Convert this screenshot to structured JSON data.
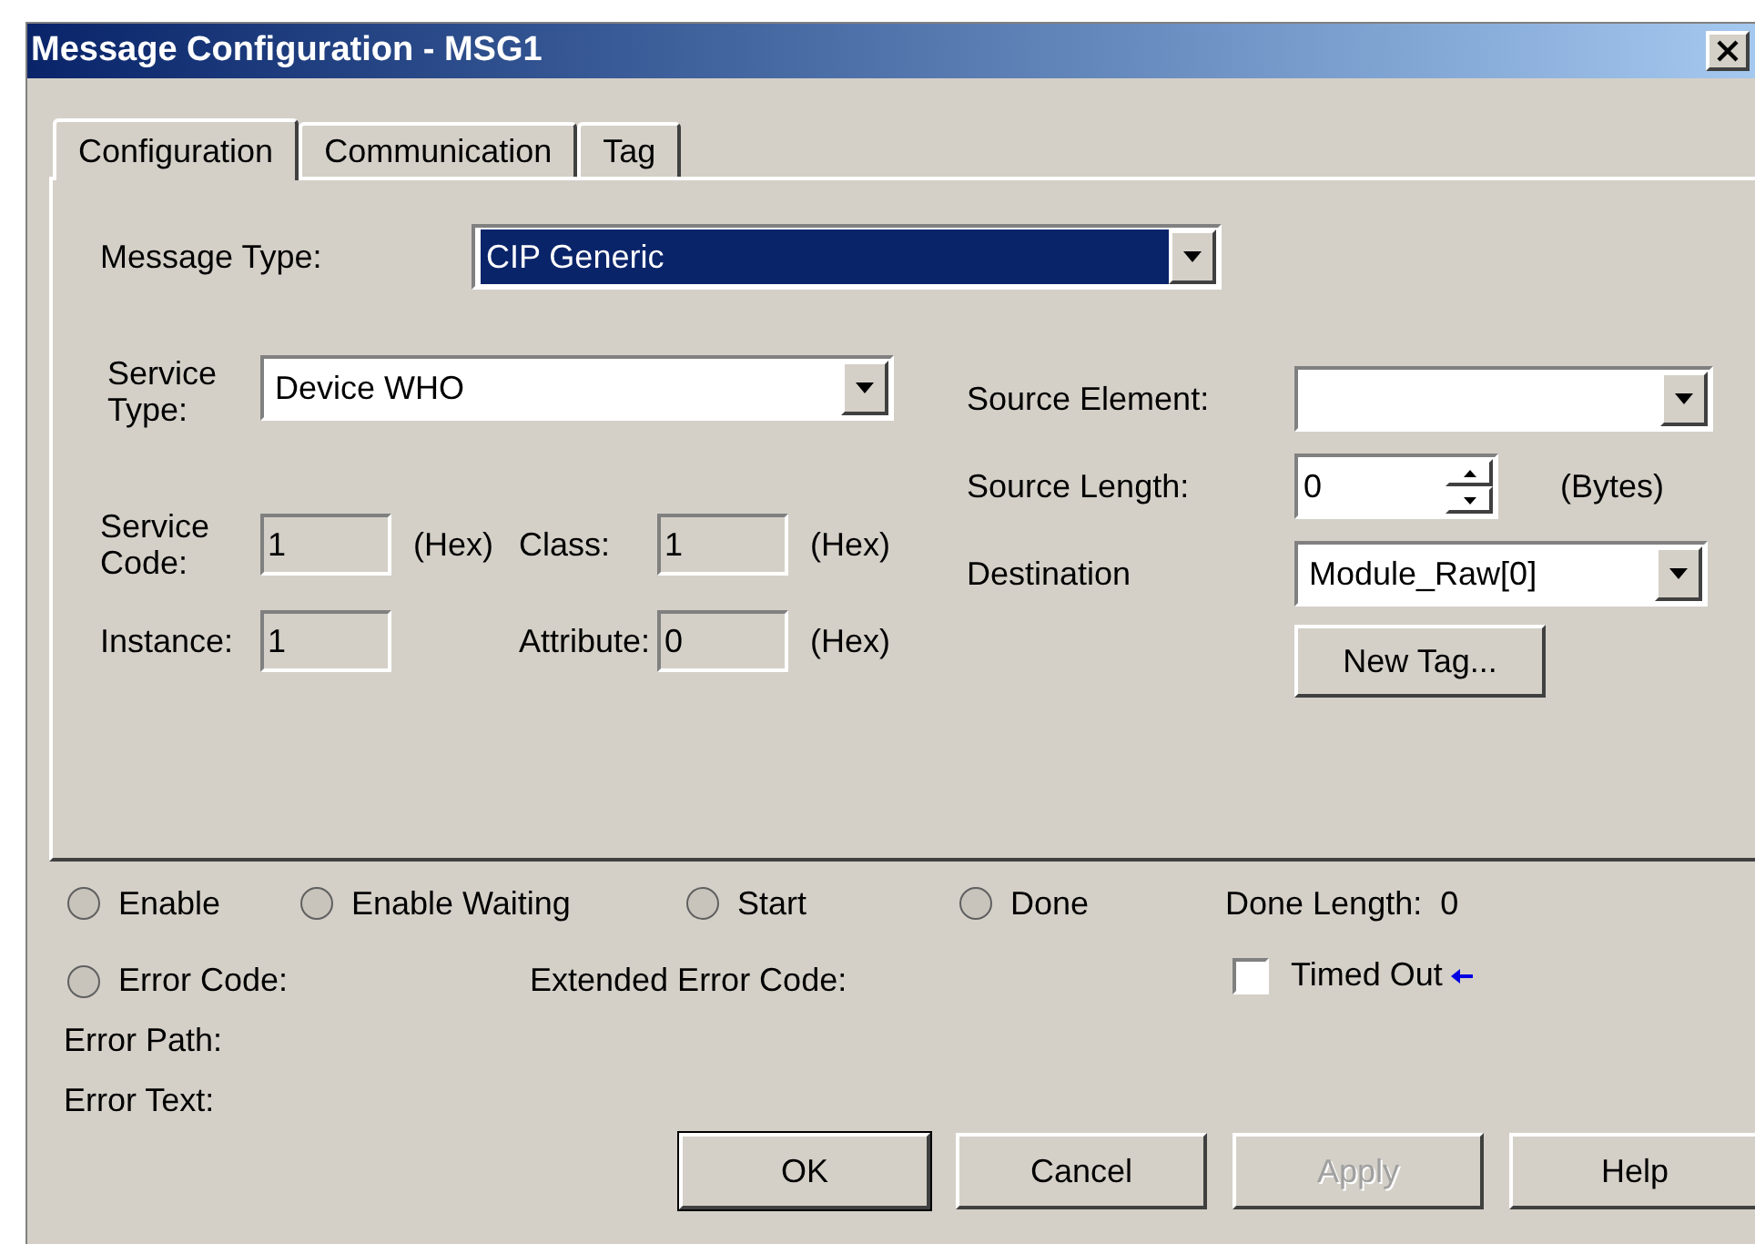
{
  "window": {
    "title": "Message Configuration - MSG1"
  },
  "tabs": [
    {
      "label": "Configuration",
      "selected": true
    },
    {
      "label": "Communication",
      "selected": false
    },
    {
      "label": "Tag",
      "selected": false
    }
  ],
  "message_type": {
    "label": "Message Type:",
    "value": "CIP Generic",
    "highlighted": true
  },
  "service_type": {
    "label": "Service Type:",
    "value": "Device WHO"
  },
  "parameters": [
    {
      "label": "Service Code:",
      "value": "1",
      "unit": "(Hex)"
    },
    {
      "label": "Class:",
      "value": "1",
      "unit": "(Hex)"
    },
    {
      "label": "Instance:",
      "value": "1"
    },
    {
      "label": "Attribute:",
      "value": "0",
      "unit": "(Hex)"
    }
  ],
  "source_element": {
    "label": "Source Element:"
  },
  "source_length": {
    "label": "Source Length:",
    "value": "0",
    "unit": "(Bytes)"
  },
  "destination": {
    "label": "Destination",
    "value": "Module_Raw[0]"
  },
  "new_tag_button": "New Tag...",
  "indicators": [
    {
      "label": "Enable",
      "on": false
    },
    {
      "label": "Enable Waiting",
      "on": false
    },
    {
      "label": "Start",
      "on": false
    },
    {
      "label": "Done",
      "on": false
    }
  ],
  "done_length": {
    "label": "Done Length:",
    "value": "0"
  },
  "error_code": {
    "label": "Error Code:",
    "on": false
  },
  "extended_error_code": {
    "label": "Extended Error Code:"
  },
  "timed_out": {
    "label": "Timed Out",
    "checked": false
  },
  "error_path": {
    "label": "Error Path:"
  },
  "error_text": {
    "label": "Error Text:"
  },
  "buttons": [
    {
      "label": "OK",
      "disabled": false,
      "default": true
    },
    {
      "label": "Cancel",
      "disabled": false,
      "default": false
    },
    {
      "label": "Apply",
      "disabled": true,
      "default": false
    },
    {
      "label": "Help",
      "disabled": false,
      "default": false
    }
  ]
}
